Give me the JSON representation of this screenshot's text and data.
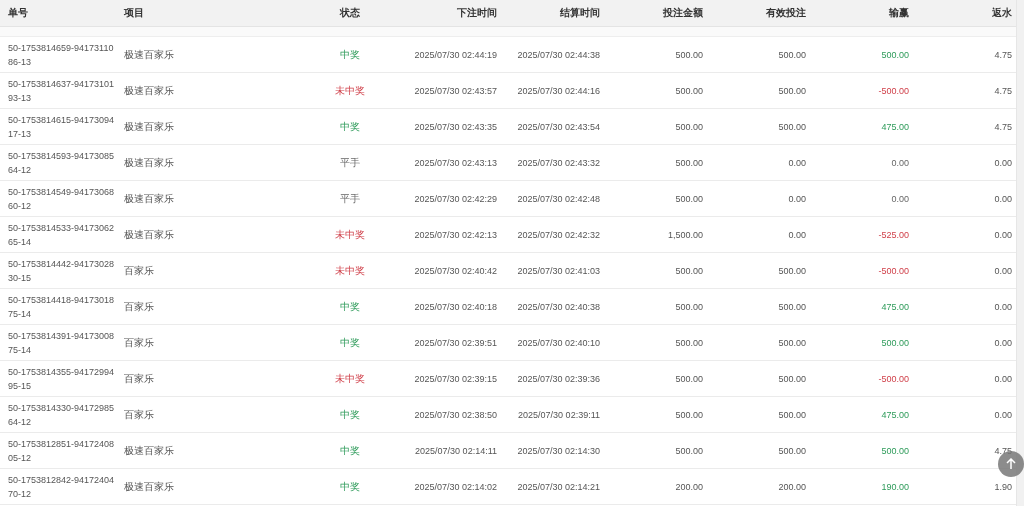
{
  "table": {
    "columns": [
      "单号",
      "项目",
      "状态",
      "下注时间",
      "结算时间",
      "投注金额",
      "有效投注",
      "输赢",
      "返水"
    ],
    "rows": [
      {
        "id": "50-1753814659-9417311086-13",
        "game": "极速百家乐",
        "status": "中奖",
        "kind": "win",
        "bet_time": "2025/07/30 02:44:19",
        "settle_time": "2025/07/30 02:44:38",
        "amount": "500.00",
        "valid": "500.00",
        "profit": "500.00",
        "rebate": "4.75"
      },
      {
        "id": "50-1753814637-9417310193-13",
        "game": "极速百家乐",
        "status": "未中奖",
        "kind": "lose",
        "bet_time": "2025/07/30 02:43:57",
        "settle_time": "2025/07/30 02:44:16",
        "amount": "500.00",
        "valid": "500.00",
        "profit": "-500.00",
        "rebate": "4.75"
      },
      {
        "id": "50-1753814615-9417309417-13",
        "game": "极速百家乐",
        "status": "中奖",
        "kind": "win",
        "bet_time": "2025/07/30 02:43:35",
        "settle_time": "2025/07/30 02:43:54",
        "amount": "500.00",
        "valid": "500.00",
        "profit": "475.00",
        "rebate": "4.75"
      },
      {
        "id": "50-1753814593-9417308564-12",
        "game": "极速百家乐",
        "status": "平手",
        "kind": "draw",
        "bet_time": "2025/07/30 02:43:13",
        "settle_time": "2025/07/30 02:43:32",
        "amount": "500.00",
        "valid": "0.00",
        "profit": "0.00",
        "rebate": "0.00"
      },
      {
        "id": "50-1753814549-9417306860-12",
        "game": "极速百家乐",
        "status": "平手",
        "kind": "draw",
        "bet_time": "2025/07/30 02:42:29",
        "settle_time": "2025/07/30 02:42:48",
        "amount": "500.00",
        "valid": "0.00",
        "profit": "0.00",
        "rebate": "0.00"
      },
      {
        "id": "50-1753814533-9417306265-14",
        "game": "极速百家乐",
        "status": "未中奖",
        "kind": "lose",
        "bet_time": "2025/07/30 02:42:13",
        "settle_time": "2025/07/30 02:42:32",
        "amount": "1,500.00",
        "valid": "0.00",
        "profit": "-525.00",
        "rebate": "0.00"
      },
      {
        "id": "50-1753814442-9417302830-15",
        "game": "百家乐",
        "status": "未中奖",
        "kind": "lose",
        "bet_time": "2025/07/30 02:40:42",
        "settle_time": "2025/07/30 02:41:03",
        "amount": "500.00",
        "valid": "500.00",
        "profit": "-500.00",
        "rebate": "0.00"
      },
      {
        "id": "50-1753814418-9417301875-14",
        "game": "百家乐",
        "status": "中奖",
        "kind": "win",
        "bet_time": "2025/07/30 02:40:18",
        "settle_time": "2025/07/30 02:40:38",
        "amount": "500.00",
        "valid": "500.00",
        "profit": "475.00",
        "rebate": "0.00"
      },
      {
        "id": "50-1753814391-9417300875-14",
        "game": "百家乐",
        "status": "中奖",
        "kind": "win",
        "bet_time": "2025/07/30 02:39:51",
        "settle_time": "2025/07/30 02:40:10",
        "amount": "500.00",
        "valid": "500.00",
        "profit": "500.00",
        "rebate": "0.00"
      },
      {
        "id": "50-1753814355-9417299495-15",
        "game": "百家乐",
        "status": "未中奖",
        "kind": "lose",
        "bet_time": "2025/07/30 02:39:15",
        "settle_time": "2025/07/30 02:39:36",
        "amount": "500.00",
        "valid": "500.00",
        "profit": "-500.00",
        "rebate": "0.00"
      },
      {
        "id": "50-1753814330-9417298564-12",
        "game": "百家乐",
        "status": "中奖",
        "kind": "win",
        "bet_time": "2025/07/30 02:38:50",
        "settle_time": "2025/07/30 02:39:11",
        "amount": "500.00",
        "valid": "500.00",
        "profit": "475.00",
        "rebate": "0.00"
      },
      {
        "id": "50-1753812851-9417240805-12",
        "game": "极速百家乐",
        "status": "中奖",
        "kind": "win",
        "bet_time": "2025/07/30 02:14:11",
        "settle_time": "2025/07/30 02:14:30",
        "amount": "500.00",
        "valid": "500.00",
        "profit": "500.00",
        "rebate": "4.75"
      },
      {
        "id": "50-1753812842-9417240470-12",
        "game": "极速百家乐",
        "status": "中奖",
        "kind": "win",
        "bet_time": "2025/07/30 02:14:02",
        "settle_time": "2025/07/30 02:14:21",
        "amount": "200.00",
        "valid": "200.00",
        "profit": "190.00",
        "rebate": "1.90"
      }
    ]
  }
}
